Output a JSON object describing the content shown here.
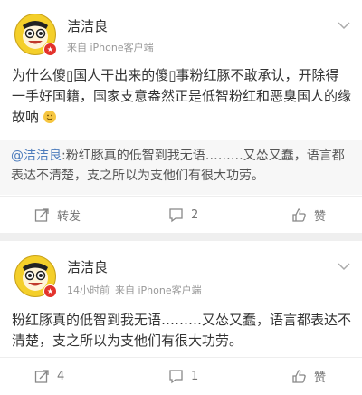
{
  "post1": {
    "author": "洁洁良",
    "meta_source": "来自 iPhone客户端",
    "body": "为什么傻▯国人干出来的傻▯事粉红豚不敢承认，开除得一手好国籍，国家支意盎然正是低智粉红和恶臭国人的缘故呐",
    "quote_mention": "@洁洁良",
    "quote_text": ":粉红豚真的低智到我无语………又怂又蠢，语言都表达不清楚，支之所以为支他们有很大功劳。",
    "actions": {
      "repost_label": "转发",
      "comment_count": "2",
      "like_label": "赞"
    }
  },
  "post2": {
    "author": "洁洁良",
    "meta_time": "14小时前",
    "meta_source": "来自 iPhone客户端",
    "body": "粉红豚真的低智到我无语………又怂又蠢，语言都表达不清楚，支之所以为支他们有很大功劳。",
    "actions": {
      "repost_count": "4",
      "comment_count": "1",
      "like_label": "赞"
    }
  },
  "colors": {
    "mention": "#4d7cbc",
    "verified_badge": "#e3332c",
    "avatar_yellow": "#f4cf2a"
  },
  "icons": [
    "avatar-cartoon",
    "verified-badge-icon",
    "chevron-down-icon",
    "repost-icon",
    "comment-icon",
    "like-icon",
    "smile-emoji-icon"
  ]
}
